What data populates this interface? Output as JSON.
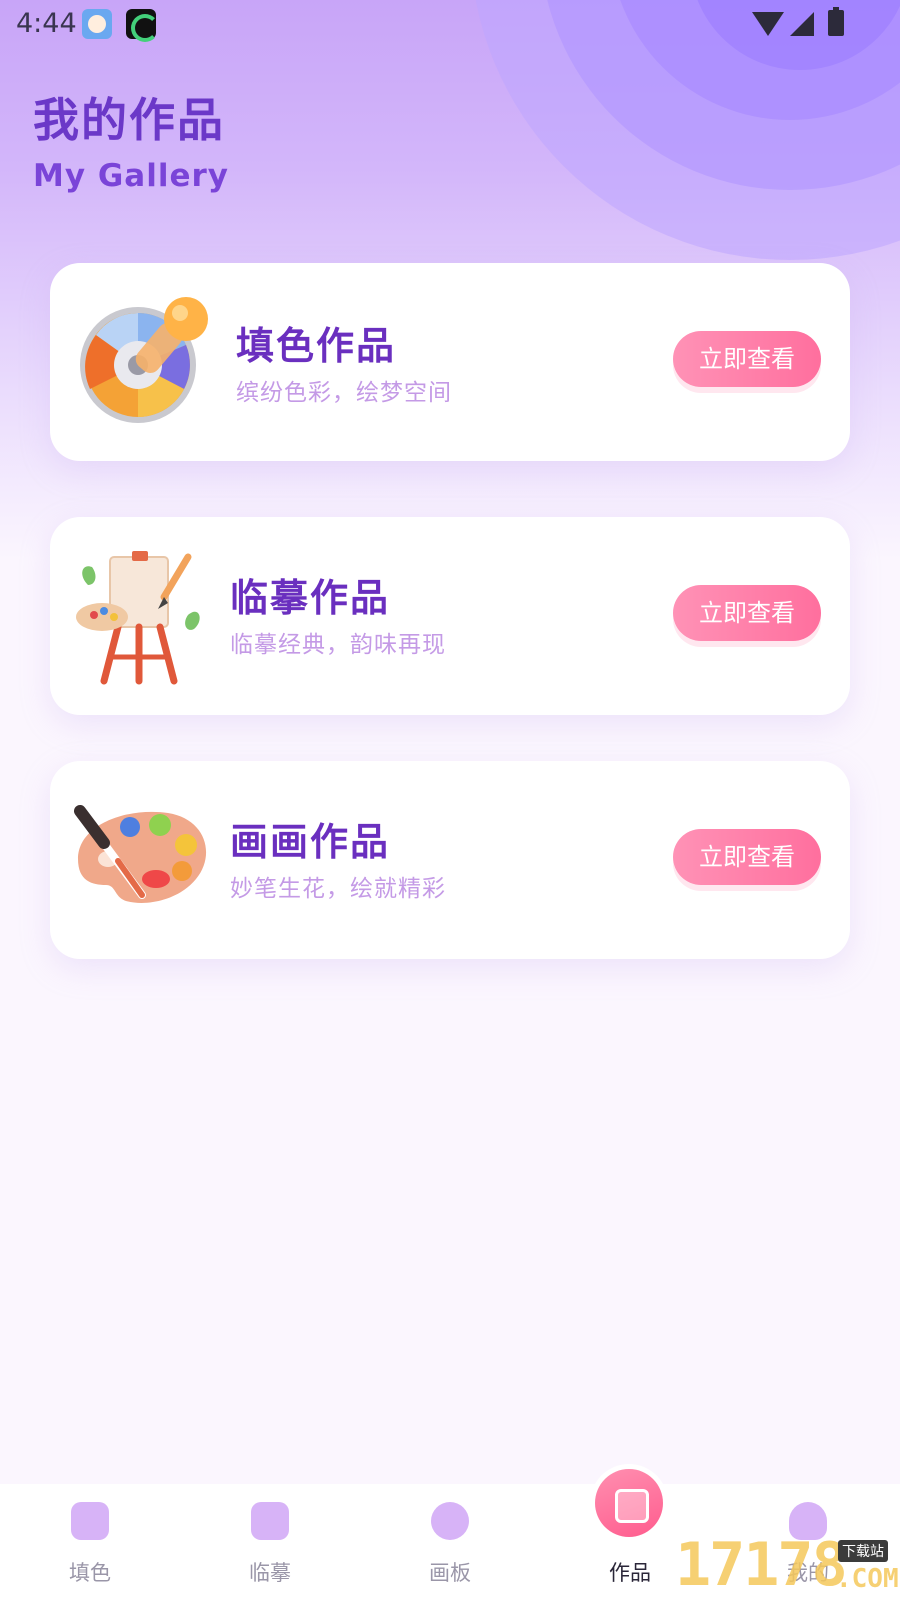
{
  "status_bar": {
    "time": "4:44"
  },
  "header": {
    "title": "我的作品",
    "subtitle": "My Gallery"
  },
  "cards": [
    {
      "title": "填色作品",
      "desc": "缤纷色彩，绘梦空间",
      "button": "立即查看",
      "illustration": "color-wheel-dropper-icon"
    },
    {
      "title": "临摹作品",
      "desc": "临摹经典，韵味再现",
      "button": "立即查看",
      "illustration": "easel-canvas-icon"
    },
    {
      "title": "画画作品",
      "desc": "妙笔生花，绘就精彩",
      "button": "立即查看",
      "illustration": "paint-palette-icon"
    }
  ],
  "bottom_nav": {
    "items": [
      {
        "label": "填色",
        "icon": "coloring-icon",
        "active": false
      },
      {
        "label": "临摹",
        "icon": "tracing-icon",
        "active": false
      },
      {
        "label": "画板",
        "icon": "palette-icon",
        "active": false
      },
      {
        "label": "作品",
        "icon": "gallery-icon",
        "active": true
      },
      {
        "label": "我的",
        "icon": "profile-icon",
        "active": false
      }
    ]
  },
  "watermark": {
    "text": "17178",
    "tag": "下载站",
    "domain": ".COM"
  },
  "colors": {
    "accent": "#6b38c8",
    "button": "#ff7aa5",
    "desc": "#c49ae6"
  }
}
